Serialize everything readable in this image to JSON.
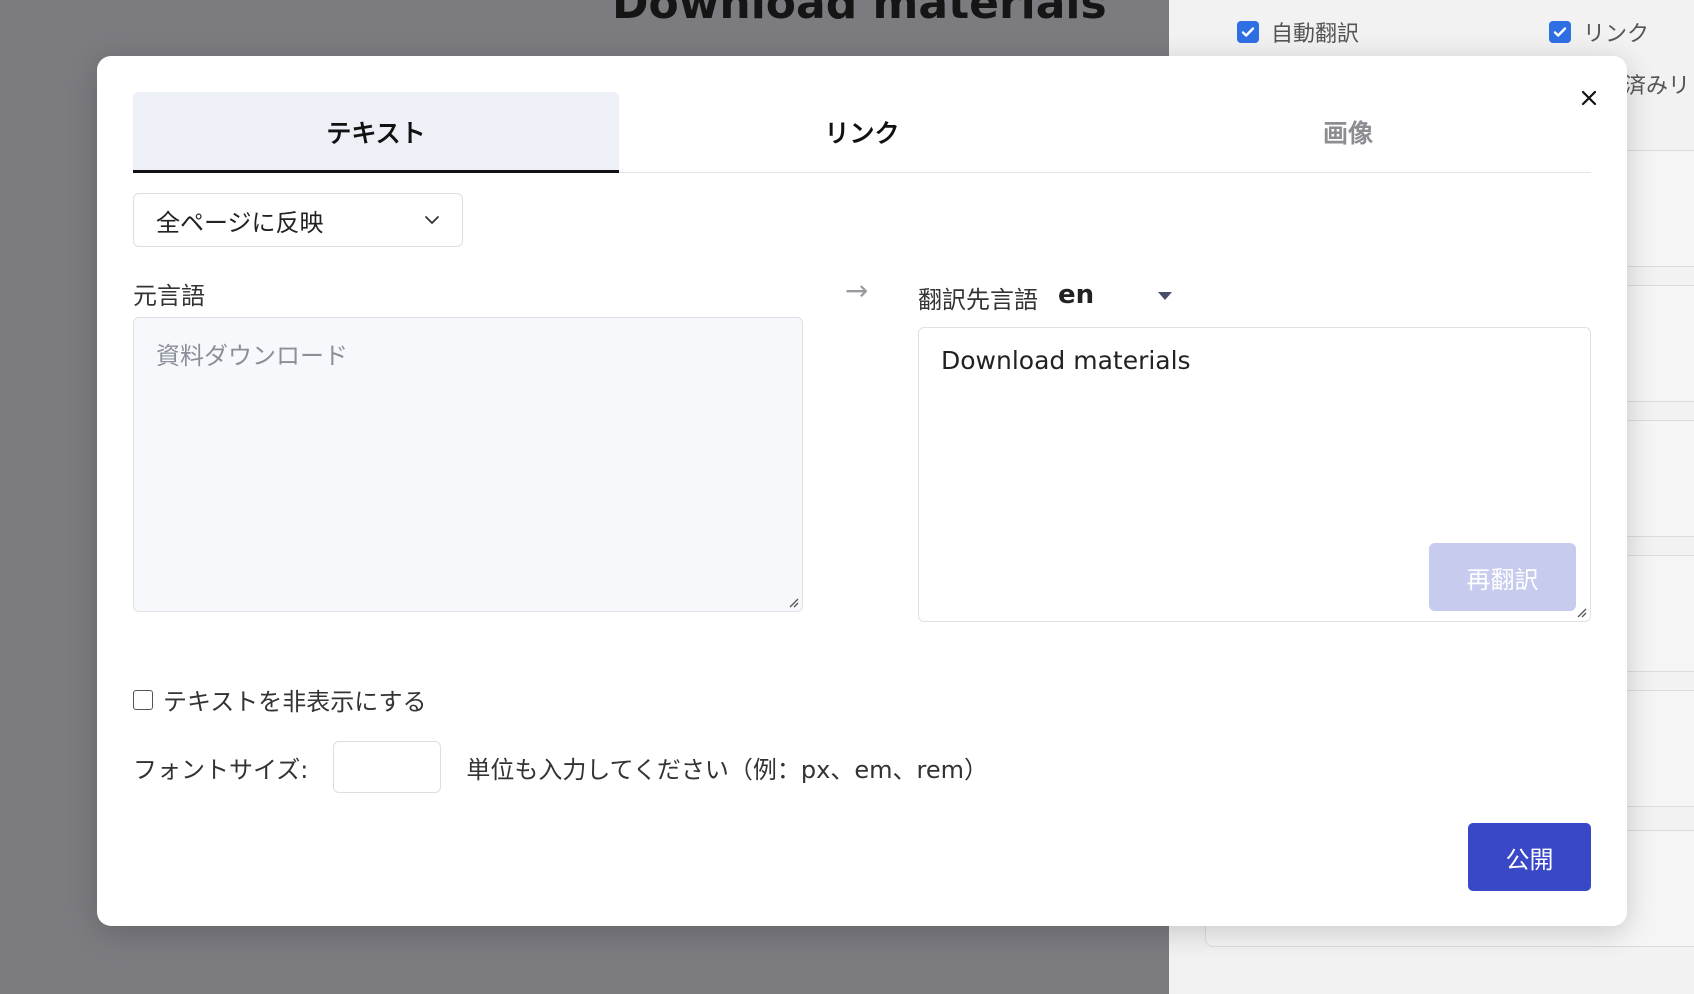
{
  "background": {
    "heading": "Download materials",
    "sidebar": {
      "checkboxes": [
        {
          "label": "自動翻訳",
          "checked": true
        },
        {
          "label": "リンク",
          "checked": true
        }
      ],
      "fragment": "済みリ"
    }
  },
  "modal": {
    "tabs": [
      {
        "label": "テキスト",
        "state": "active"
      },
      {
        "label": "リンク",
        "state": "normal"
      },
      {
        "label": "画像",
        "state": "disabled"
      }
    ],
    "scope_select": {
      "value": "全ページに反映"
    },
    "source": {
      "label": "元言語",
      "placeholder": "資料ダウンロード"
    },
    "arrow": "→",
    "target": {
      "label": "翻訳先言語",
      "language": "en",
      "value": "Download materials",
      "retranslate_label": "再翻訳"
    },
    "hide_text": {
      "label": "テキストを非表示にする",
      "checked": false
    },
    "font_size": {
      "label": "フォントサイズ:",
      "value": "",
      "hint": "単位も入力してください（例：px、em、rem）"
    },
    "publish_label": "公開"
  },
  "colors": {
    "primary": "#3848c6",
    "primary_disabled": "#c7cbee",
    "checkbox_checked": "#2f6fe4",
    "tab_active_bg": "#eef0f8"
  },
  "icons": {
    "close": "close-icon",
    "chevron": "chevron-down-icon",
    "caret": "caret-down-icon",
    "check": "check-icon"
  }
}
